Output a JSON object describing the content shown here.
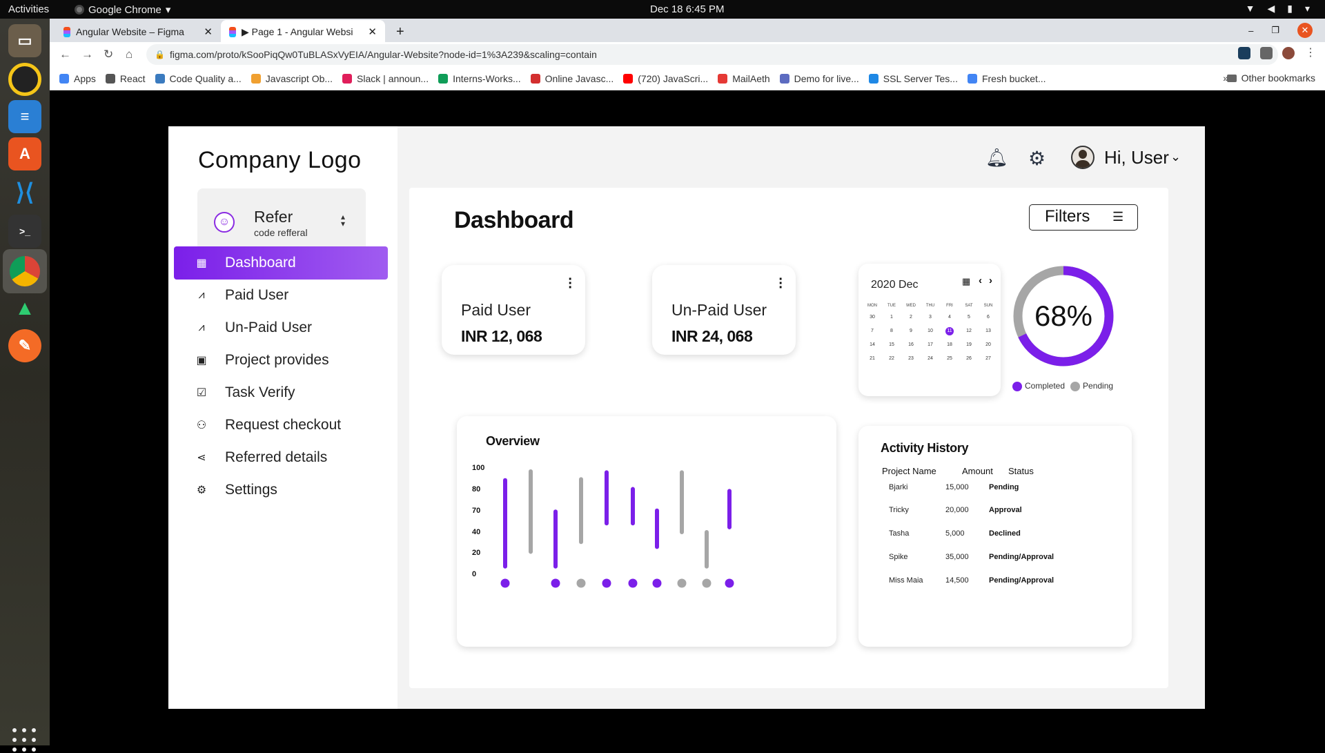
{
  "system": {
    "activities": "Activities",
    "app_name": "Google Chrome",
    "clock": "Dec 18   6:45 PM"
  },
  "browser": {
    "tabs": [
      {
        "title": "Angular Website – Figma"
      },
      {
        "title": "▶ Page 1 - Angular Websi"
      }
    ],
    "new_tab": "+",
    "url": "figma.com/proto/kSooPiqQw0TuBLASxVyEIA/Angular-Website?node-id=1%3A239&scaling=contain",
    "bookmarks": [
      {
        "label": "Apps",
        "color": "#4285f4"
      },
      {
        "label": "React",
        "color": "#555555"
      },
      {
        "label": "Code Quality a...",
        "color": "#3b7bbf"
      },
      {
        "label": "Javascript Ob...",
        "color": "#f0a030"
      },
      {
        "label": "Slack | announ...",
        "color": "#e01e5a"
      },
      {
        "label": "Interns-Works...",
        "color": "#0f9d58"
      },
      {
        "label": "Online Javasc...",
        "color": "#d32f2f"
      },
      {
        "label": "(720) JavaScri...",
        "color": "#ff0000"
      },
      {
        "label": "MailAeth",
        "color": "#e53935"
      },
      {
        "label": "Demo for live...",
        "color": "#5c6bc0"
      },
      {
        "label": "SSL Server Tes...",
        "color": "#1e88e5"
      },
      {
        "label": "Fresh bucket...",
        "color": "#4285f4"
      }
    ],
    "bookmarks_overflow": "»",
    "other_bookmarks": "Other bookmarks"
  },
  "sidebar": {
    "logo": "Company Logo",
    "refer": {
      "title": "Refer",
      "subtitle": "code refferal"
    },
    "items": [
      {
        "label": "Dashboard",
        "icon": "grid-icon",
        "glyph": "▦",
        "active": true
      },
      {
        "label": "Paid User",
        "icon": "chart-icon",
        "glyph": "⩘",
        "active": false
      },
      {
        "label": "Un-Paid User",
        "icon": "chart-icon",
        "glyph": "⩘",
        "active": false
      },
      {
        "label": "Project provides",
        "icon": "calendar-icon",
        "glyph": "▣",
        "active": false
      },
      {
        "label": "Task Verify",
        "icon": "calendar-check-icon",
        "glyph": "☑",
        "active": false
      },
      {
        "label": "Request checkout",
        "icon": "user-plus-icon",
        "glyph": "⚇",
        "active": false
      },
      {
        "label": "Referred details",
        "icon": "share-icon",
        "glyph": "⋖",
        "active": false
      },
      {
        "label": "Settings",
        "icon": "gear-icon",
        "glyph": "⚙",
        "active": false
      }
    ]
  },
  "header": {
    "greeting": "Hi, User"
  },
  "dashboard": {
    "title": "Dashboard",
    "filters_label": "Filters",
    "cards": [
      {
        "label": "Paid User",
        "amount": "INR 12, 068"
      },
      {
        "label": "Un-Paid User",
        "amount": "INR 24, 068"
      }
    ]
  },
  "calendar": {
    "month": "2020 Dec",
    "weekdays": [
      "MON",
      "TUE",
      "WED",
      "THU",
      "FRI",
      "SAT",
      "SUN"
    ],
    "days": [
      "30",
      "1",
      "2",
      "3",
      "4",
      "5",
      "6",
      "7",
      "8",
      "9",
      "10",
      "11",
      "12",
      "13",
      "14",
      "15",
      "16",
      "17",
      "18",
      "19",
      "20",
      "21",
      "22",
      "23",
      "24",
      "25",
      "26",
      "27"
    ],
    "selected_day": "11"
  },
  "progress": {
    "percent_label": "68%",
    "completed_fraction": 0.68,
    "legend": [
      {
        "label": "Completed",
        "color": "#7b1fe9"
      },
      {
        "label": "Pending",
        "color": "#a6a6a6"
      }
    ]
  },
  "chart_data": {
    "type": "bar",
    "title": "Overview",
    "y_ticks": [
      "100",
      "80",
      "70",
      "40",
      "20",
      "0"
    ],
    "colors": {
      "purple": "#7b1fe9",
      "gray": "#a6a6a6"
    },
    "series": [
      {
        "color": "purple",
        "low": 3,
        "high": 91,
        "dot": true
      },
      {
        "color": "gray",
        "low": 18,
        "high": 100,
        "dot": false
      },
      {
        "color": "purple",
        "low": 3,
        "high": 59,
        "dot": true
      },
      {
        "color": "gray",
        "low": 28,
        "high": 92,
        "dot": true
      },
      {
        "color": "purple",
        "low": 47,
        "high": 99,
        "dot": true
      },
      {
        "color": "purple",
        "low": 47,
        "high": 82,
        "dot": true
      },
      {
        "color": "purple",
        "low": 23,
        "high": 60,
        "dot": true
      },
      {
        "color": "gray",
        "low": 38,
        "high": 99,
        "dot": true
      },
      {
        "color": "gray",
        "low": 3,
        "high": 38,
        "dot": true
      },
      {
        "color": "purple",
        "low": 43,
        "high": 80,
        "dot": true
      }
    ]
  },
  "activity": {
    "title": "Activity History",
    "headers": [
      "Project Name",
      "Amount",
      "Status"
    ],
    "rows": [
      {
        "name": "Bjarki",
        "amount": "15,000",
        "status": "Pending"
      },
      {
        "name": "Tricky",
        "amount": "20,000",
        "status": "Approval"
      },
      {
        "name": "Tasha",
        "amount": "5,000",
        "status": "Declined"
      },
      {
        "name": "Spike",
        "amount": "35,000",
        "status": "Pending/Approval"
      },
      {
        "name": "Miss Maia",
        "amount": "14,500",
        "status": "Pending/Approval"
      }
    ]
  }
}
